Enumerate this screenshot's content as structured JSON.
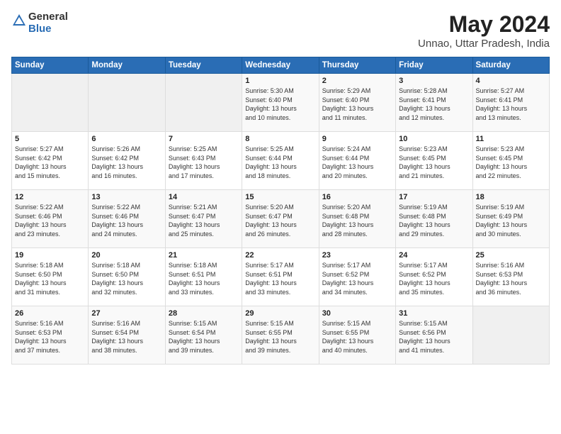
{
  "header": {
    "logo_general": "General",
    "logo_blue": "Blue",
    "month_year": "May 2024",
    "location": "Unnao, Uttar Pradesh, India"
  },
  "weekdays": [
    "Sunday",
    "Monday",
    "Tuesday",
    "Wednesday",
    "Thursday",
    "Friday",
    "Saturday"
  ],
  "weeks": [
    [
      {
        "day": "",
        "info": ""
      },
      {
        "day": "",
        "info": ""
      },
      {
        "day": "",
        "info": ""
      },
      {
        "day": "1",
        "info": "Sunrise: 5:30 AM\nSunset: 6:40 PM\nDaylight: 13 hours\nand 10 minutes."
      },
      {
        "day": "2",
        "info": "Sunrise: 5:29 AM\nSunset: 6:40 PM\nDaylight: 13 hours\nand 11 minutes."
      },
      {
        "day": "3",
        "info": "Sunrise: 5:28 AM\nSunset: 6:41 PM\nDaylight: 13 hours\nand 12 minutes."
      },
      {
        "day": "4",
        "info": "Sunrise: 5:27 AM\nSunset: 6:41 PM\nDaylight: 13 hours\nand 13 minutes."
      }
    ],
    [
      {
        "day": "5",
        "info": "Sunrise: 5:27 AM\nSunset: 6:42 PM\nDaylight: 13 hours\nand 15 minutes."
      },
      {
        "day": "6",
        "info": "Sunrise: 5:26 AM\nSunset: 6:42 PM\nDaylight: 13 hours\nand 16 minutes."
      },
      {
        "day": "7",
        "info": "Sunrise: 5:25 AM\nSunset: 6:43 PM\nDaylight: 13 hours\nand 17 minutes."
      },
      {
        "day": "8",
        "info": "Sunrise: 5:25 AM\nSunset: 6:44 PM\nDaylight: 13 hours\nand 18 minutes."
      },
      {
        "day": "9",
        "info": "Sunrise: 5:24 AM\nSunset: 6:44 PM\nDaylight: 13 hours\nand 20 minutes."
      },
      {
        "day": "10",
        "info": "Sunrise: 5:23 AM\nSunset: 6:45 PM\nDaylight: 13 hours\nand 21 minutes."
      },
      {
        "day": "11",
        "info": "Sunrise: 5:23 AM\nSunset: 6:45 PM\nDaylight: 13 hours\nand 22 minutes."
      }
    ],
    [
      {
        "day": "12",
        "info": "Sunrise: 5:22 AM\nSunset: 6:46 PM\nDaylight: 13 hours\nand 23 minutes."
      },
      {
        "day": "13",
        "info": "Sunrise: 5:22 AM\nSunset: 6:46 PM\nDaylight: 13 hours\nand 24 minutes."
      },
      {
        "day": "14",
        "info": "Sunrise: 5:21 AM\nSunset: 6:47 PM\nDaylight: 13 hours\nand 25 minutes."
      },
      {
        "day": "15",
        "info": "Sunrise: 5:20 AM\nSunset: 6:47 PM\nDaylight: 13 hours\nand 26 minutes."
      },
      {
        "day": "16",
        "info": "Sunrise: 5:20 AM\nSunset: 6:48 PM\nDaylight: 13 hours\nand 28 minutes."
      },
      {
        "day": "17",
        "info": "Sunrise: 5:19 AM\nSunset: 6:48 PM\nDaylight: 13 hours\nand 29 minutes."
      },
      {
        "day": "18",
        "info": "Sunrise: 5:19 AM\nSunset: 6:49 PM\nDaylight: 13 hours\nand 30 minutes."
      }
    ],
    [
      {
        "day": "19",
        "info": "Sunrise: 5:18 AM\nSunset: 6:50 PM\nDaylight: 13 hours\nand 31 minutes."
      },
      {
        "day": "20",
        "info": "Sunrise: 5:18 AM\nSunset: 6:50 PM\nDaylight: 13 hours\nand 32 minutes."
      },
      {
        "day": "21",
        "info": "Sunrise: 5:18 AM\nSunset: 6:51 PM\nDaylight: 13 hours\nand 33 minutes."
      },
      {
        "day": "22",
        "info": "Sunrise: 5:17 AM\nSunset: 6:51 PM\nDaylight: 13 hours\nand 33 minutes."
      },
      {
        "day": "23",
        "info": "Sunrise: 5:17 AM\nSunset: 6:52 PM\nDaylight: 13 hours\nand 34 minutes."
      },
      {
        "day": "24",
        "info": "Sunrise: 5:17 AM\nSunset: 6:52 PM\nDaylight: 13 hours\nand 35 minutes."
      },
      {
        "day": "25",
        "info": "Sunrise: 5:16 AM\nSunset: 6:53 PM\nDaylight: 13 hours\nand 36 minutes."
      }
    ],
    [
      {
        "day": "26",
        "info": "Sunrise: 5:16 AM\nSunset: 6:53 PM\nDaylight: 13 hours\nand 37 minutes."
      },
      {
        "day": "27",
        "info": "Sunrise: 5:16 AM\nSunset: 6:54 PM\nDaylight: 13 hours\nand 38 minutes."
      },
      {
        "day": "28",
        "info": "Sunrise: 5:15 AM\nSunset: 6:54 PM\nDaylight: 13 hours\nand 39 minutes."
      },
      {
        "day": "29",
        "info": "Sunrise: 5:15 AM\nSunset: 6:55 PM\nDaylight: 13 hours\nand 39 minutes."
      },
      {
        "day": "30",
        "info": "Sunrise: 5:15 AM\nSunset: 6:55 PM\nDaylight: 13 hours\nand 40 minutes."
      },
      {
        "day": "31",
        "info": "Sunrise: 5:15 AM\nSunset: 6:56 PM\nDaylight: 13 hours\nand 41 minutes."
      },
      {
        "day": "",
        "info": ""
      }
    ]
  ]
}
